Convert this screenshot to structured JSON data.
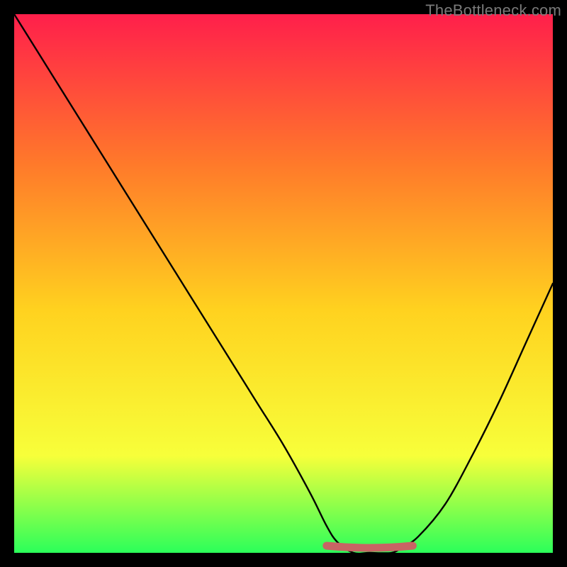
{
  "watermark": "TheBottleneck.com",
  "colors": {
    "frame": "#000000",
    "gradient_top": "#ff1f4b",
    "gradient_mid1": "#ff7a2a",
    "gradient_mid2": "#ffd21f",
    "gradient_mid3": "#f7ff3a",
    "gradient_bottom": "#2bff5a",
    "curve": "#000000",
    "marker": "#c86464"
  },
  "chart_data": {
    "type": "line",
    "title": "",
    "xlabel": "",
    "ylabel": "",
    "xlim": [
      0,
      100
    ],
    "ylim": [
      0,
      100
    ],
    "x": [
      0,
      5,
      10,
      15,
      20,
      25,
      30,
      35,
      40,
      45,
      50,
      55,
      58,
      60,
      63,
      66,
      70,
      72,
      75,
      80,
      85,
      90,
      95,
      100
    ],
    "values": [
      100,
      92,
      84,
      76,
      68,
      60,
      52,
      44,
      36,
      28,
      20,
      11,
      5,
      2,
      0,
      0,
      0,
      1,
      3,
      9,
      18,
      28,
      39,
      50
    ],
    "flat_region": {
      "x_start": 58,
      "x_end": 74,
      "y": 0
    }
  }
}
